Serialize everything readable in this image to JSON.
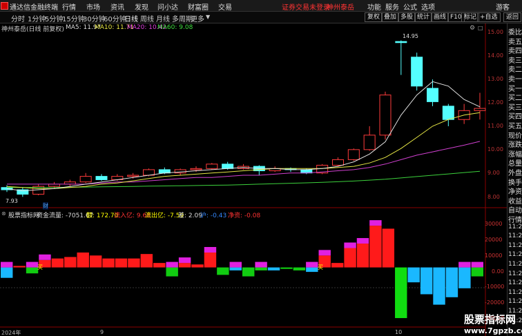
{
  "topbar": {
    "app_title": "通达信金融终端",
    "menus": [
      "行情",
      "市场",
      "资讯",
      "发现",
      "问小达",
      "财富圈",
      "交易"
    ],
    "notice_left": "证券交易未登录",
    "notice_right": "神州泰岳",
    "right_buttons": [
      "功能",
      "服务",
      "公式",
      "选项"
    ],
    "guest": "游客"
  },
  "periodbar": {
    "tabs": [
      "分时",
      "1分钟",
      "5分钟",
      "15分钟",
      "30分钟",
      "60分钟",
      "日线",
      "周线",
      "月线",
      "多周期",
      "更多"
    ],
    "active": "日线",
    "tools": [
      "复权",
      "叠加",
      "多股",
      "统计",
      "画线",
      "F10",
      "标记",
      "+自选",
      "返回"
    ]
  },
  "chart_header": {
    "stock": "神州泰岳(日线 前复权)",
    "ma5": "MA5: 11.97",
    "ma10": "MA10: 11.71",
    "ma20": "MA20: 10.42",
    "ma60": "MA60: 9.08"
  },
  "indicator_header": {
    "name": "股票指标网",
    "flow_label": "资金流量: -7051.67",
    "bold_label": "额: 172.70",
    "inflow": "流入亿: 9.68",
    "outflow": "流出亿: -7.59",
    "diff": "差: 2.09",
    "hu": "沪: -0.43",
    "net": "净资: -0.08"
  },
  "price_axis": [
    "15.00",
    "14.00",
    "13.00",
    "12.00",
    "11.00",
    "10.00",
    "9.00",
    "8.00"
  ],
  "ind_axis": [
    "30000",
    "20000",
    "10000",
    "0.00",
    "-10000",
    "-20000",
    "-30000"
  ],
  "date_labels": [
    "2024年",
    "9",
    "10"
  ],
  "annotations": {
    "high": "14.95",
    "low": "7.93",
    "cai": "财",
    "buy": "买"
  },
  "right_panel": [
    "委比",
    "卖五",
    "卖四",
    "卖三",
    "卖二",
    "卖一",
    "买一",
    "买二",
    "买三",
    "买四",
    "买五",
    "现价",
    "涨跌",
    "涨幅",
    "总量",
    "外盘",
    "换手",
    "净资",
    "收益",
    "自动",
    "行情",
    "11:26",
    "11:26",
    "11:26",
    "11:26",
    "11:26",
    "11:26",
    "11:26",
    "11:26",
    "11:26",
    "11:26",
    "11:26"
  ],
  "watermark": {
    "line1": "股票指标网",
    "line2": "www.7gpzb.com"
  },
  "chart_data": {
    "type": "candlestick",
    "candles": [
      {
        "o": 8.35,
        "h": 8.45,
        "l": 8.15,
        "c": 8.25
      },
      {
        "o": 8.25,
        "h": 8.35,
        "l": 7.93,
        "c": 8.05
      },
      {
        "o": 8.05,
        "h": 8.5,
        "l": 8.0,
        "c": 8.4
      },
      {
        "o": 8.4,
        "h": 8.6,
        "l": 8.3,
        "c": 8.5
      },
      {
        "o": 8.5,
        "h": 8.7,
        "l": 8.4,
        "c": 8.6
      },
      {
        "o": 8.6,
        "h": 9.0,
        "l": 8.55,
        "c": 8.85
      },
      {
        "o": 8.85,
        "h": 8.95,
        "l": 8.65,
        "c": 8.7
      },
      {
        "o": 8.7,
        "h": 8.95,
        "l": 8.65,
        "c": 8.85
      },
      {
        "o": 8.85,
        "h": 9.0,
        "l": 8.75,
        "c": 8.9
      },
      {
        "o": 8.9,
        "h": 9.2,
        "l": 8.85,
        "c": 9.15
      },
      {
        "o": 9.15,
        "h": 9.25,
        "l": 8.95,
        "c": 9.0
      },
      {
        "o": 9.0,
        "h": 9.2,
        "l": 8.9,
        "c": 9.15
      },
      {
        "o": 9.15,
        "h": 9.3,
        "l": 9.05,
        "c": 9.2
      },
      {
        "o": 9.2,
        "h": 9.45,
        "l": 9.15,
        "c": 9.4
      },
      {
        "o": 9.4,
        "h": 9.5,
        "l": 9.15,
        "c": 9.2
      },
      {
        "o": 9.2,
        "h": 9.4,
        "l": 9.15,
        "c": 9.3
      },
      {
        "o": 9.3,
        "h": 9.35,
        "l": 8.9,
        "c": 9.1
      },
      {
        "o": 9.1,
        "h": 9.3,
        "l": 9.05,
        "c": 9.2
      },
      {
        "o": 9.2,
        "h": 9.25,
        "l": 9.05,
        "c": 9.15
      },
      {
        "o": 9.15,
        "h": 9.2,
        "l": 8.95,
        "c": 9.0
      },
      {
        "o": 9.0,
        "h": 9.4,
        "l": 8.95,
        "c": 9.35
      },
      {
        "o": 9.35,
        "h": 9.7,
        "l": 9.3,
        "c": 9.6
      },
      {
        "o": 9.6,
        "h": 10.1,
        "l": 9.55,
        "c": 10.05
      },
      {
        "o": 10.05,
        "h": 11.1,
        "l": 10.0,
        "c": 10.7
      },
      {
        "o": 10.7,
        "h": 12.65,
        "l": 10.5,
        "c": 12.5
      },
      {
        "o": 14.9,
        "h": 14.95,
        "l": 13.4,
        "c": 14.85
      },
      {
        "o": 14.2,
        "h": 14.4,
        "l": 12.7,
        "c": 12.9
      },
      {
        "o": 12.8,
        "h": 13.2,
        "l": 12.0,
        "c": 12.2
      },
      {
        "o": 12.0,
        "h": 12.1,
        "l": 11.1,
        "c": 11.4
      },
      {
        "o": 11.4,
        "h": 12.1,
        "l": 11.2,
        "c": 11.8
      },
      {
        "o": 11.8,
        "h": 12.6,
        "l": 11.4,
        "c": 11.9
      }
    ],
    "ma5": [
      8.3,
      8.2,
      8.25,
      8.3,
      8.4,
      8.5,
      8.6,
      8.7,
      8.8,
      8.9,
      9.0,
      9.05,
      9.1,
      9.15,
      9.2,
      9.25,
      9.2,
      9.2,
      9.15,
      9.15,
      9.2,
      9.3,
      9.5,
      9.85,
      10.4,
      11.6,
      12.5,
      13.1,
      12.9,
      12.3,
      11.97
    ],
    "ma10": [
      8.4,
      8.35,
      8.3,
      8.3,
      8.35,
      8.4,
      8.5,
      8.55,
      8.65,
      8.75,
      8.85,
      8.9,
      8.95,
      9.0,
      9.05,
      9.1,
      9.15,
      9.2,
      9.2,
      9.2,
      9.2,
      9.25,
      9.3,
      9.45,
      9.7,
      10.1,
      10.6,
      11.1,
      11.4,
      11.6,
      11.71
    ],
    "ma20": [
      8.5,
      8.5,
      8.5,
      8.5,
      8.5,
      8.5,
      8.55,
      8.6,
      8.6,
      8.65,
      8.7,
      8.75,
      8.8,
      8.8,
      8.85,
      8.9,
      8.9,
      8.95,
      9.0,
      9.0,
      9.05,
      9.1,
      9.15,
      9.25,
      9.4,
      9.6,
      9.8,
      9.95,
      10.1,
      10.25,
      10.42
    ],
    "ma60": [
      8.35,
      8.35,
      8.35,
      8.35,
      8.36,
      8.37,
      8.38,
      8.39,
      8.4,
      8.41,
      8.42,
      8.43,
      8.44,
      8.45,
      8.46,
      8.48,
      8.5,
      8.52,
      8.54,
      8.56,
      8.58,
      8.61,
      8.64,
      8.68,
      8.72,
      8.78,
      8.84,
      8.9,
      8.96,
      9.02,
      9.08
    ],
    "ind_values": [
      -7000,
      1000,
      -4000,
      5000,
      6000,
      7000,
      10000,
      8000,
      6000,
      6000,
      6000,
      9000,
      3000,
      -6000,
      3000,
      2000,
      10000,
      -5000,
      -2000,
      -6000,
      -2000,
      -2000,
      -1000,
      -2000,
      -3000,
      8000,
      3000,
      13000,
      16000,
      28000,
      26000,
      -34000,
      -10000,
      -18000,
      -25000,
      -20000,
      -14000,
      -6000
    ],
    "ind_caps": [
      1,
      0,
      1,
      1,
      0,
      0,
      0,
      0,
      0,
      0,
      0,
      0,
      0,
      1,
      1,
      0,
      1,
      0,
      1,
      0,
      1,
      0,
      0,
      0,
      1,
      1,
      0,
      1,
      1,
      1,
      0,
      0,
      0,
      0,
      0,
      0,
      1,
      1
    ],
    "price_range": [
      7.6,
      15.4
    ],
    "ind_range": [
      -40000,
      35000
    ]
  }
}
